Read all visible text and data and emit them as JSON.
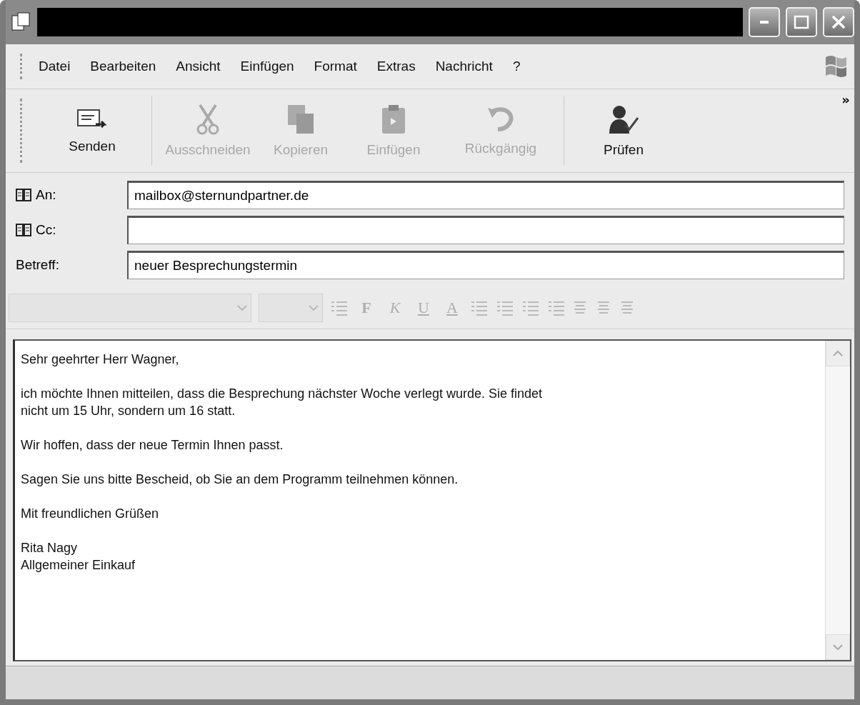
{
  "menu": [
    "Datei",
    "Bearbeiten",
    "Ansicht",
    "Einfügen",
    "Format",
    "Extras",
    "Nachricht",
    "?"
  ],
  "toolbar": [
    {
      "kind": "send",
      "label": "Senden",
      "disabled": false
    },
    {
      "kind": "cut",
      "label": "Ausschneiden",
      "disabled": true
    },
    {
      "kind": "copy",
      "label": "Kopieren",
      "disabled": true
    },
    {
      "kind": "paste",
      "label": "Einfügen",
      "disabled": true
    },
    {
      "kind": "undo",
      "label": "Rückgängig",
      "disabled": true
    },
    {
      "kind": "check",
      "label": "Prüfen",
      "disabled": false
    }
  ],
  "toolbar_more": "»",
  "fields": [
    {
      "kind": "address",
      "label": "An:",
      "value": "mailbox@sternundpartner.de"
    },
    {
      "kind": "address",
      "label": "Cc:"
    },
    {
      "kind": "plain",
      "label": "Betreff:",
      "value": "neuer Besprechungstermin"
    }
  ],
  "format_bar": {
    "disabled": true,
    "text_buttons": [
      {
        "kind": "bold",
        "label": "F"
      },
      {
        "kind": "italic",
        "label": "K"
      },
      {
        "kind": "underline",
        "label": "U"
      },
      {
        "kind": "color",
        "label": "A"
      }
    ]
  },
  "body": [
    [
      "Sehr geehrter Herr Wagner,"
    ],
    [
      "ich möchte Ihnen mitteilen, dass die Besprechung nächster Woche verlegt wurde. Sie findet",
      "nicht um 15 Uhr, sondern um 16 statt."
    ],
    [
      "Wir hoffen, dass der neue Termin Ihnen passt."
    ],
    [
      "Sagen Sie uns bitte Bescheid, ob Sie an dem Programm teilnehmen können."
    ],
    [
      "Mit freundlichen Grüßen"
    ],
    [
      "Rita Nagy",
      "Allgemeiner Einkauf"
    ]
  ]
}
